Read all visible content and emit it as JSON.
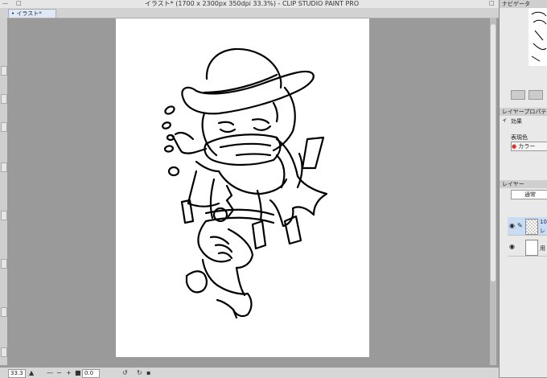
{
  "window": {
    "title": "イラスト* (1700 x 2300px 350dpi 33.3%)  - CLIP STUDIO PAINT PRO",
    "tab_label": "イラスト*"
  },
  "status": {
    "zoom": "33.3",
    "angle": "0.0"
  },
  "panels": {
    "navigator": "ナビゲータ",
    "layer_property": "レイヤープロパティ",
    "effect_label": "効果",
    "expression_color": "表現色",
    "color_button": "カラー",
    "layer": "レイヤー",
    "blend_mode": "通常",
    "layer_name": "10",
    "layer_name2": "レ",
    "paper_name": "用"
  }
}
